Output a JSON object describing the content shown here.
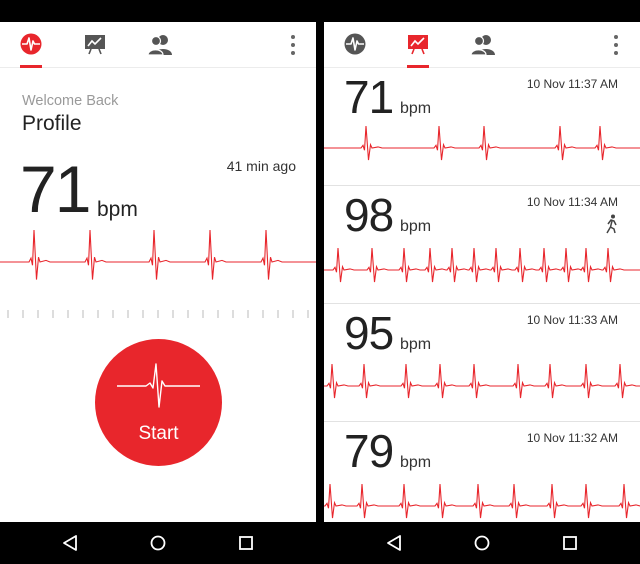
{
  "left_screen": {
    "tabs": [
      {
        "icon": "heartbeat-icon",
        "active": true
      },
      {
        "icon": "trend-chart-icon",
        "active": false
      },
      {
        "icon": "people-icon",
        "active": false
      }
    ],
    "welcome_text": "Welcome Back",
    "profile_label": "Profile",
    "heart_rate": "71",
    "unit": "bpm",
    "time_ago": "41 min ago",
    "start_label": "Start"
  },
  "right_screen": {
    "tabs": [
      {
        "icon": "heartbeat-icon",
        "active": false
      },
      {
        "icon": "trend-chart-icon",
        "active": true
      },
      {
        "icon": "people-icon",
        "active": false
      }
    ],
    "readings": [
      {
        "bpm": "71",
        "unit": "bpm",
        "timestamp": "10 Nov 11:37 AM",
        "walking": false
      },
      {
        "bpm": "98",
        "unit": "bpm",
        "timestamp": "10 Nov 11:34 AM",
        "walking": true
      },
      {
        "bpm": "95",
        "unit": "bpm",
        "timestamp": "10 Nov 11:33 AM",
        "walking": false
      },
      {
        "bpm": "79",
        "unit": "bpm",
        "timestamp": "10 Nov 11:32 AM",
        "walking": false
      }
    ]
  },
  "navigation": {
    "buttons": [
      "back-icon",
      "home-icon",
      "recents-icon"
    ]
  },
  "colors": {
    "accent": "#e8262c",
    "tab_inactive": "#555555",
    "text": "#222222"
  }
}
